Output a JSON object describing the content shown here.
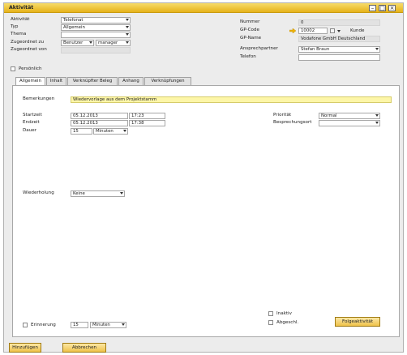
{
  "window": {
    "title": "Aktivität"
  },
  "left_fields": {
    "aktivitaet": {
      "label": "Aktivität",
      "value": "Telefonat"
    },
    "typ": {
      "label": "Typ",
      "value": "Allgemein"
    },
    "thema": {
      "label": "Thema",
      "value": ""
    },
    "zugeordnet_zu": {
      "label": "Zugeordnet zu",
      "value_a": "Benutzer",
      "value_b": "manager"
    },
    "zugeordnet_von": {
      "label": "Zugeordnet von",
      "value": ""
    },
    "persoenlich": {
      "label": "Persönlich",
      "checked": false
    }
  },
  "right_fields": {
    "nummer": {
      "label": "Nummer",
      "value": "0"
    },
    "gp_code": {
      "label": "GP-Code",
      "value": "10002",
      "suffix": "Kunde"
    },
    "gp_name": {
      "label": "GP-Name",
      "value": "Vodafone GmbH Deutschland"
    },
    "ansprechpartner": {
      "label": "Ansprechpartner",
      "value": "Stefan Braun"
    },
    "telefon": {
      "label": "Telefon",
      "value": ""
    }
  },
  "tabs": [
    {
      "label": "Allgemein",
      "active": true
    },
    {
      "label": "Inhalt",
      "active": false
    },
    {
      "label": "Verknüpfter Beleg",
      "active": false
    },
    {
      "label": "Anhang",
      "active": false
    },
    {
      "label": "Verknüpfungen",
      "active": false
    }
  ],
  "general": {
    "bemerkungen": {
      "label": "Bemerkungen",
      "value": "Wiedervorlage aus dem Projektstamm"
    },
    "startzeit": {
      "label": "Startzeit",
      "date": "05.12.2013",
      "time": "17:23"
    },
    "endzeit": {
      "label": "Endzeit",
      "date": "05.12.2013",
      "time": "17:38"
    },
    "dauer": {
      "label": "Dauer",
      "value": "15",
      "unit": "Minuten"
    },
    "prioritaet": {
      "label": "Priorität",
      "value": "Normal"
    },
    "besprechungsort": {
      "label": "Besprechungsort",
      "value": ""
    },
    "wiederholung": {
      "label": "Wiederholung",
      "value": "Keine"
    },
    "erinnerung": {
      "label": "Erinnerung",
      "value": "15",
      "unit": "Minuten",
      "checked": false
    },
    "inaktiv": {
      "label": "Inaktiv",
      "checked": false
    },
    "abgeschl": {
      "label": "Abgeschl.",
      "checked": false
    },
    "folgeaktivitaet_label": "Folgeaktivität"
  },
  "footer": {
    "add_label": "Hinzufügen",
    "cancel_label": "Abbrechen"
  },
  "colors": {
    "title_bar": "#efc24a",
    "highlight_field": "#fdf6a8",
    "button": "#efc24a",
    "link_arrow": "#f0b400"
  }
}
